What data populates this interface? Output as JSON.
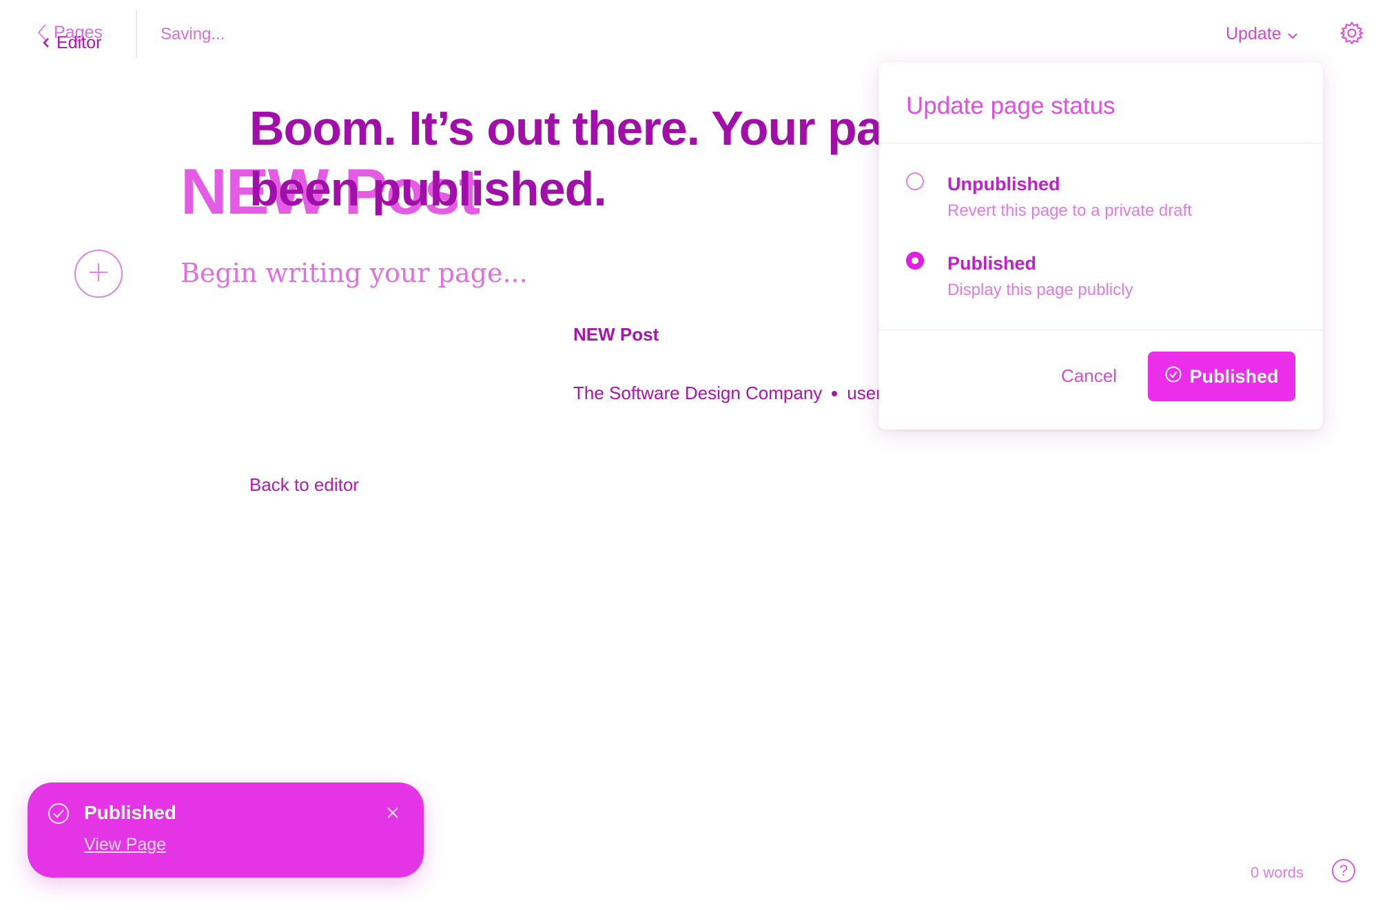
{
  "topbar": {
    "back_label": "Pages",
    "editor_label": "Editor",
    "status_text": "Saving...",
    "update_label": "Update"
  },
  "editor": {
    "title": "NEW Post",
    "body_placeholder": "Begin writing your page..."
  },
  "published_view": {
    "headline": "Boom. It’s out there. Your page has been published.",
    "post_title": "NEW Post",
    "company": "The Software Design Company",
    "author": "user",
    "back_link": "Back to editor"
  },
  "status_popover": {
    "title": "Update page status",
    "options": [
      {
        "label": "Unpublished",
        "description": "Revert this page to a private draft",
        "selected": false
      },
      {
        "label": "Published",
        "description": "Display this page publicly",
        "selected": true
      }
    ],
    "cancel_label": "Cancel",
    "confirm_label": "Published"
  },
  "toast": {
    "title": "Published",
    "link": "View Page"
  },
  "footer": {
    "word_count": "0 words",
    "help_label": "?"
  },
  "colors": {
    "accent": "#e534e5",
    "text_dark": "#a814ac",
    "text_light": "#e07ce0"
  }
}
